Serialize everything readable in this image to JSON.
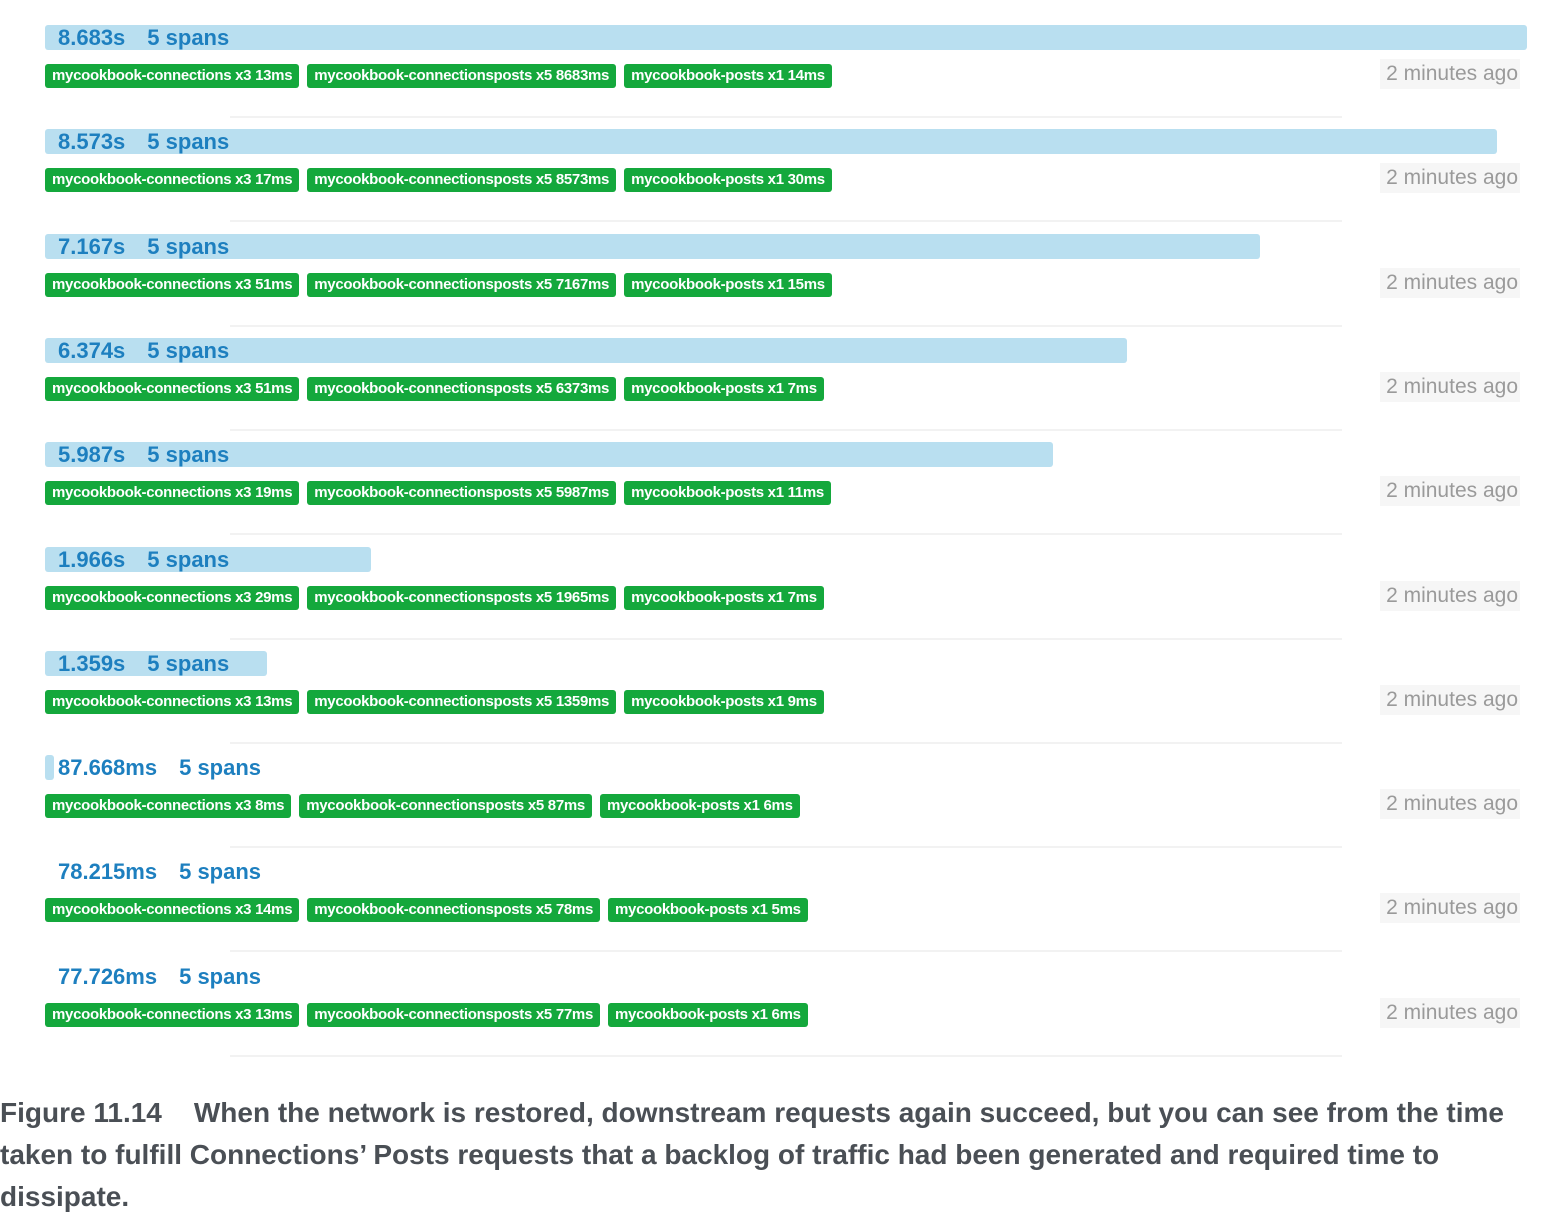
{
  "traces": [
    {
      "duration": "8.683s",
      "spans": "5 spans",
      "bar_fraction": 1.0,
      "tags": [
        "mycookbook-connections x3 13ms",
        "mycookbook-connectionsposts x5 8683ms",
        "mycookbook-posts x1 14ms"
      ],
      "time_ago": "2 minutes ago"
    },
    {
      "duration": "8.573s",
      "spans": "5 spans",
      "bar_fraction": 0.98,
      "tags": [
        "mycookbook-connections x3 17ms",
        "mycookbook-connectionsposts x5 8573ms",
        "mycookbook-posts x1 30ms"
      ],
      "time_ago": "2 minutes ago"
    },
    {
      "duration": "7.167s",
      "spans": "5 spans",
      "bar_fraction": 0.82,
      "tags": [
        "mycookbook-connections x3 51ms",
        "mycookbook-connectionsposts x5 7167ms",
        "mycookbook-posts x1 15ms"
      ],
      "time_ago": "2 minutes ago"
    },
    {
      "duration": "6.374s",
      "spans": "5 spans",
      "bar_fraction": 0.73,
      "tags": [
        "mycookbook-connections x3 51ms",
        "mycookbook-connectionsposts x5 6373ms",
        "mycookbook-posts x1 7ms"
      ],
      "time_ago": "2 minutes ago"
    },
    {
      "duration": "5.987s",
      "spans": "5 spans",
      "bar_fraction": 0.68,
      "tags": [
        "mycookbook-connections x3 19ms",
        "mycookbook-connectionsposts x5 5987ms",
        "mycookbook-posts x1 11ms"
      ],
      "time_ago": "2 minutes ago"
    },
    {
      "duration": "1.966s",
      "spans": "5 spans",
      "bar_fraction": 0.22,
      "tags": [
        "mycookbook-connections x3 29ms",
        "mycookbook-connectionsposts x5 1965ms",
        "mycookbook-posts x1 7ms"
      ],
      "time_ago": "2 minutes ago"
    },
    {
      "duration": "1.359s",
      "spans": "5 spans",
      "bar_fraction": 0.15,
      "tags": [
        "mycookbook-connections x3 13ms",
        "mycookbook-connectionsposts x5 1359ms",
        "mycookbook-posts x1 9ms"
      ],
      "time_ago": "2 minutes ago"
    },
    {
      "duration": "87.668ms",
      "spans": "5 spans",
      "bar_fraction": 0.006,
      "tags": [
        "mycookbook-connections x3 8ms",
        "mycookbook-connectionsposts x5 87ms",
        "mycookbook-posts x1 6ms"
      ],
      "time_ago": "2 minutes ago"
    },
    {
      "duration": "78.215ms",
      "spans": "5 spans",
      "bar_fraction": 0.0,
      "tags": [
        "mycookbook-connections x3 14ms",
        "mycookbook-connectionsposts x5 78ms",
        "mycookbook-posts x1 5ms"
      ],
      "time_ago": "2 minutes ago"
    },
    {
      "duration": "77.726ms",
      "spans": "5 spans",
      "bar_fraction": 0.0,
      "tags": [
        "mycookbook-connections x3 13ms",
        "mycookbook-connectionsposts x5 77ms",
        "mycookbook-posts x1 6ms"
      ],
      "time_ago": "2 minutes ago"
    }
  ],
  "caption": {
    "label": "Figure 11.14",
    "text": "When the network is restored, downstream requests again succeed, but you can see from the time taken to fulfill Connections’ Posts requests that a backlog of traffic had been generated and required time to dissipate."
  },
  "colors": {
    "bar": "#b9dff0",
    "bar_text": "#1d7fbf",
    "tag": "#14a83c",
    "time_ago": "#9a9a9a"
  }
}
